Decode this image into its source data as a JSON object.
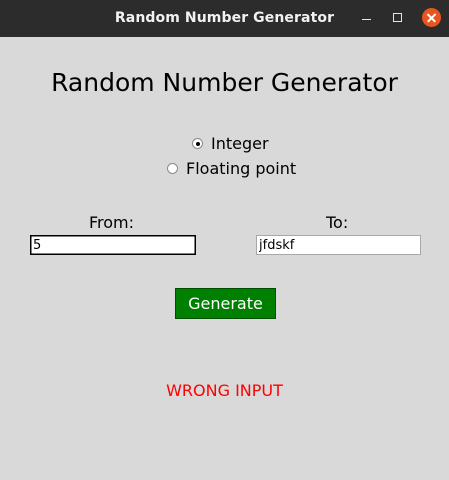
{
  "window": {
    "title": "Random Number Generator"
  },
  "main": {
    "heading": "Random Number Generator",
    "number_type": {
      "options": [
        {
          "label": "Integer",
          "selected": true
        },
        {
          "label": "Floating point",
          "selected": false
        }
      ]
    },
    "from": {
      "label": "From:",
      "value": "5"
    },
    "to": {
      "label": "To:",
      "value": "jfdskf"
    },
    "generate_label": "Generate",
    "status_message": "WRONG INPUT"
  },
  "colors": {
    "generate_button": "#008000",
    "error_text": "#ff0000",
    "close_button": "#e95420"
  }
}
